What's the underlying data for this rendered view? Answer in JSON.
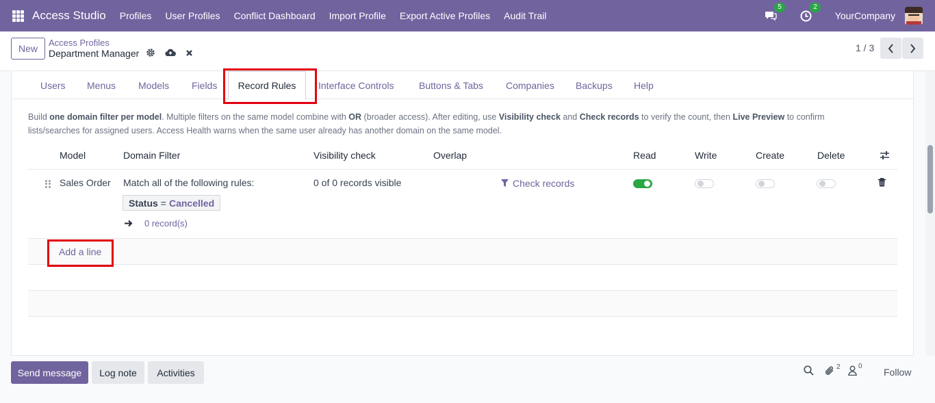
{
  "navbar": {
    "brand": "Access Studio",
    "menu": [
      "Profiles",
      "User Profiles",
      "Conflict Dashboard",
      "Import Profile",
      "Export Active Profiles",
      "Audit Trail"
    ],
    "messages_badge": "5",
    "activities_badge": "2",
    "company": "YourCompany"
  },
  "control": {
    "new_label": "New",
    "breadcrumb_parent": "Access Profiles",
    "breadcrumb_current": "Department Manager",
    "pager": "1 / 3"
  },
  "tabs": {
    "items": [
      "Users",
      "Menus",
      "Models",
      "Fields",
      "Record Rules",
      "Interface Controls",
      "Buttons & Tabs",
      "Companies",
      "Backups",
      "Help"
    ],
    "active": "Record Rules"
  },
  "description": {
    "p1": "Build ",
    "b1": "one domain filter per model",
    "p2": ". Multiple filters on the same model combine with ",
    "b2": "OR",
    "p3": " (broader access). After editing, use ",
    "b3": "Visibility check",
    "p4": " and ",
    "b4": "Check records",
    "p5": " to verify the count, then ",
    "b5": "Live Preview",
    "p6": " to confirm lists/searches for assigned users. Access Health warns when the same user already has another domain on the same model."
  },
  "table": {
    "headers": {
      "model": "Model",
      "domain": "Domain Filter",
      "visibility": "Visibility check",
      "overlap": "Overlap",
      "read": "Read",
      "write": "Write",
      "create": "Create",
      "delete": "Delete"
    },
    "rows": [
      {
        "model": "Sales Order",
        "domain_intro": "Match all of the following rules:",
        "rule_field": "Status",
        "rule_operator": "=",
        "rule_value": "Cancelled",
        "record_count": "0 record(s)",
        "visibility": "0 of 0 records visible",
        "check_records": "Check records",
        "read": true,
        "write": false,
        "create": false,
        "delete": false
      }
    ],
    "add_line": "Add a line"
  },
  "chatter": {
    "send_message": "Send message",
    "log_note": "Log note",
    "activities": "Activities",
    "attachments_count": "2",
    "followers_count": "0",
    "follow": "Follow"
  },
  "colors": {
    "brand": "#71639e",
    "toggle_on": "#28a745",
    "highlight": "#e3000f"
  }
}
